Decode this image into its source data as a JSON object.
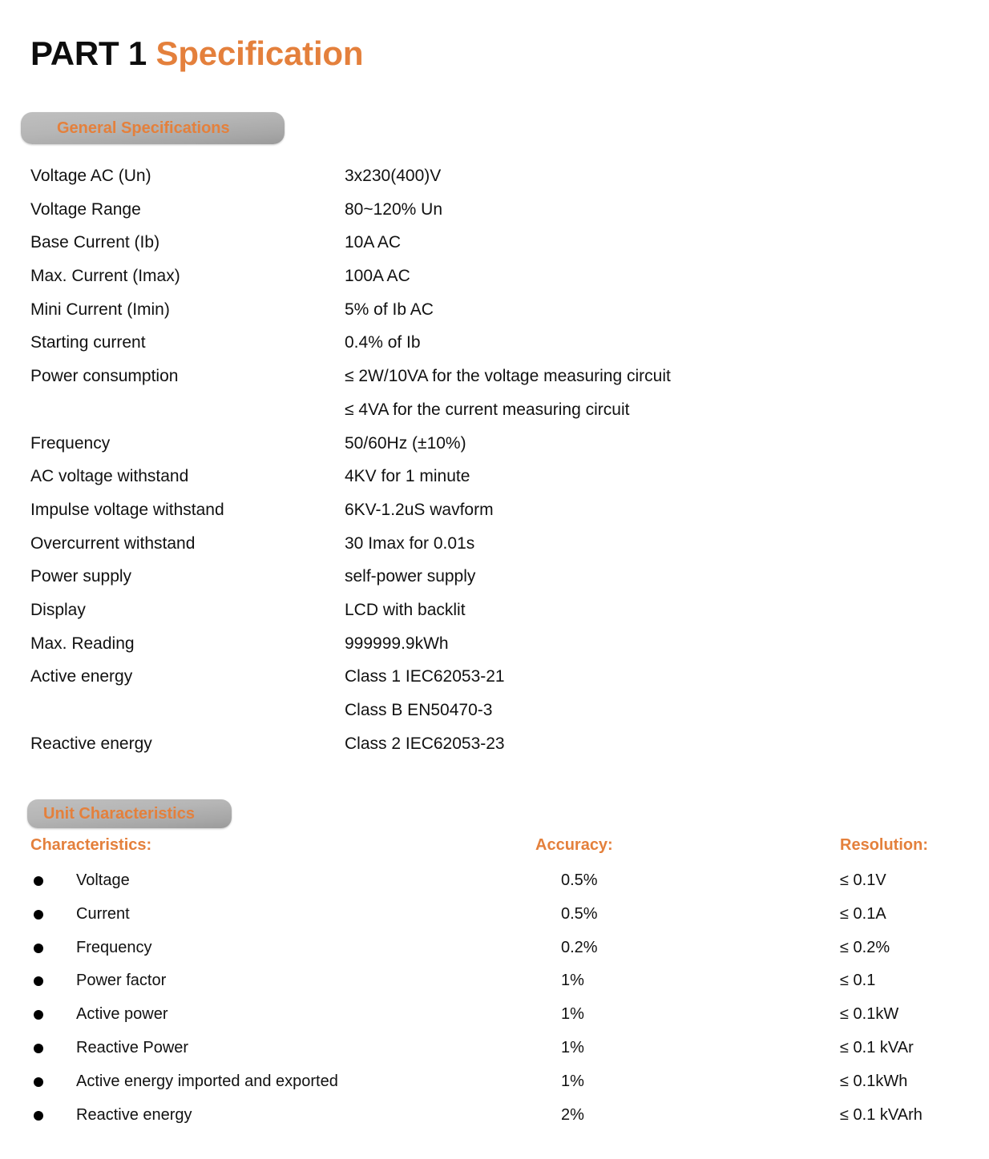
{
  "document": {
    "title_part": "PART 1",
    "title_accent": "Specification",
    "accent_color": "#E4803C",
    "banner_color": "#b6b6b6"
  },
  "general_specifications": {
    "banner_label": "General Specifications",
    "rows": [
      {
        "key": "Voltage AC (Un)",
        "value": "3x230(400)V"
      },
      {
        "key": "Voltage Range",
        "value": "80~120% Un"
      },
      {
        "key": "Base Current (Ib)",
        "value": "10A AC"
      },
      {
        "key": "Max. Current (Imax)",
        "value": "100A AC"
      },
      {
        "key": "Mini Current (Imin)",
        "value": "5% of Ib AC"
      },
      {
        "key": "Starting current",
        "value": "0.4% of Ib"
      },
      {
        "key": "Power consumption",
        "value": "≤ 2W/10VA for the voltage measuring circuit"
      },
      {
        "key": "",
        "value": "≤ 4VA for the current measuring circuit"
      },
      {
        "key": "Frequency",
        "value": "50/60Hz (±10%)"
      },
      {
        "key": "AC voltage withstand",
        "value": "4KV for 1 minute"
      },
      {
        "key": "Impulse voltage withstand",
        "value": "6KV-1.2uS wavform"
      },
      {
        "key": "Overcurrent withstand",
        "value": "30 Imax for 0.01s"
      },
      {
        "key": "Power supply",
        "value": "self-power supply"
      },
      {
        "key": "Display",
        "value": "LCD with backlit"
      },
      {
        "key": "Max. Reading",
        "value": "999999.9kWh"
      },
      {
        "key": "Active energy",
        "value": "Class 1 IEC62053-21"
      },
      {
        "key": "",
        "value": "Class B EN50470-3"
      },
      {
        "key": "Reactive energy",
        "value": "Class 2 IEC62053-23"
      }
    ]
  },
  "unit_characteristics": {
    "banner_label": "Unit Characteristics",
    "headers": {
      "characteristics": "Characteristics:",
      "accuracy": "Accuracy:",
      "resolution": "Resolution:"
    },
    "rows": [
      {
        "label": "Voltage",
        "accuracy": "0.5%",
        "resolution": "≤ 0.1V"
      },
      {
        "label": "Current",
        "accuracy": "0.5%",
        "resolution": "≤ 0.1A"
      },
      {
        "label": "Frequency",
        "accuracy": "0.2%",
        "resolution": "≤ 0.2%"
      },
      {
        "label": "Power factor",
        "accuracy": "1%",
        "resolution": "≤ 0.1"
      },
      {
        "label": "Active power",
        "accuracy": "1%",
        "resolution": "≤ 0.1kW"
      },
      {
        "label": "Reactive Power",
        "accuracy": "1%",
        "resolution": "≤ 0.1 kVAr"
      },
      {
        "label": "Active energy imported and exported",
        "accuracy": "1%",
        "resolution": "≤ 0.1kWh"
      },
      {
        "label": "Reactive energy",
        "accuracy": "2%",
        "resolution": "≤ 0.1 kVArh"
      }
    ]
  }
}
